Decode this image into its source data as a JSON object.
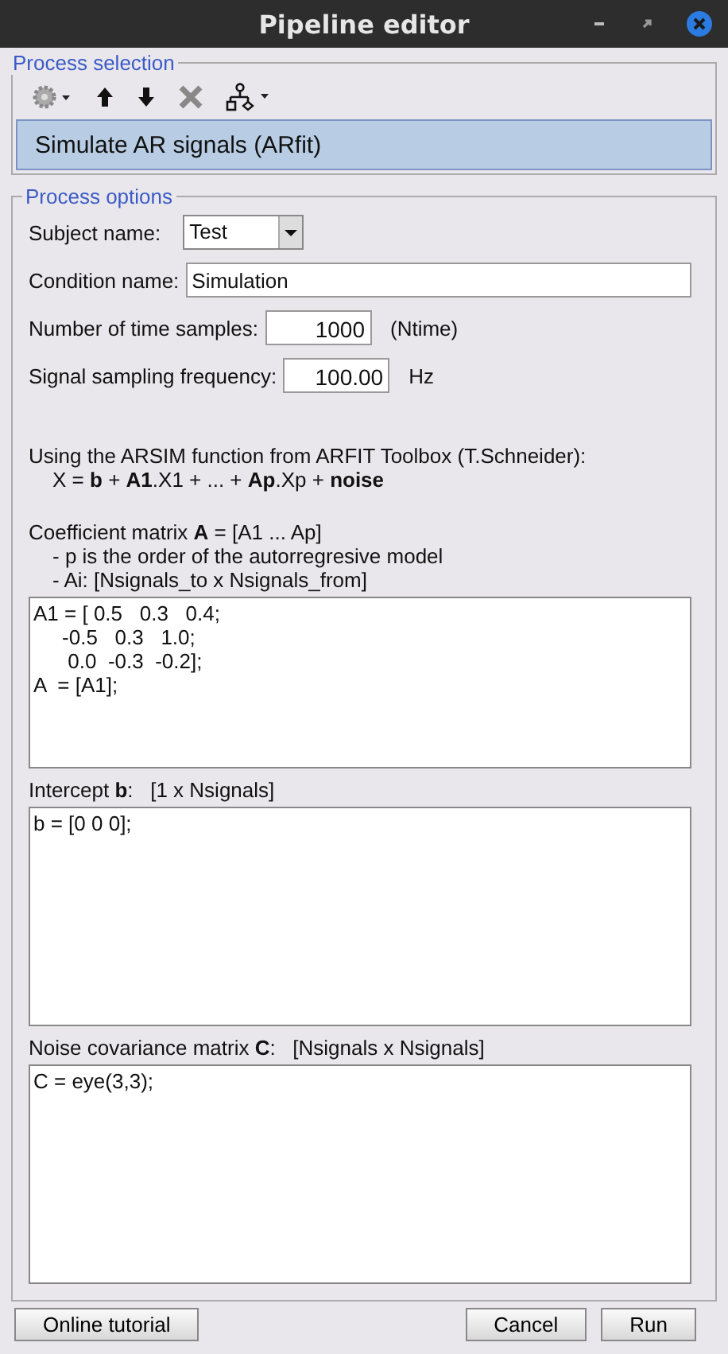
{
  "window": {
    "title": "Pipeline editor"
  },
  "process_selection": {
    "legend": "Process selection",
    "processes": [
      {
        "label": "Simulate AR signals (ARfit)",
        "selected": true
      }
    ]
  },
  "process_options": {
    "legend": "Process options",
    "subject": {
      "label": "Subject name:",
      "value": "Test"
    },
    "condition": {
      "label": "Condition name:",
      "value": "Simulation"
    },
    "time_samples": {
      "label": "Number of time samples:",
      "value": "1000",
      "unit": "(Ntime)"
    },
    "sampling_frequency": {
      "label": "Signal sampling frequency:",
      "value": "100.00",
      "unit": "Hz"
    },
    "description": [
      "Using the ARSIM function from ARFIT Toolbox (T.Schneider):",
      "X = **b** + **A1**.X1 + ... + **Ap**.Xp + **noise**"
    ],
    "coefficients": {
      "label": "Coefficient matrix **A** = [A1 ... Ap]",
      "notes": [
        "- p is the order of the autorregresive model",
        "- Ai: [Nsignals_to x Nsignals_from]"
      ],
      "value": "A1 = [ 0.5   0.3   0.4;\n     -0.5   0.3   1.0;\n      0.0  -0.3  -0.2];\nA  = [A1];"
    },
    "intercept": {
      "label": "Intercept **b**:   [1 x Nsignals]",
      "value": "b = [0 0 0];"
    },
    "noise": {
      "label": "Noise covariance matrix **C**:   [Nsignals x Nsignals]",
      "value": "C = eye(3,3);"
    }
  },
  "buttons": [
    {
      "label": "Online tutorial",
      "kind": "left"
    },
    {
      "label": "Cancel",
      "kind": "right"
    },
    {
      "label": "Run",
      "kind": "right"
    }
  ]
}
